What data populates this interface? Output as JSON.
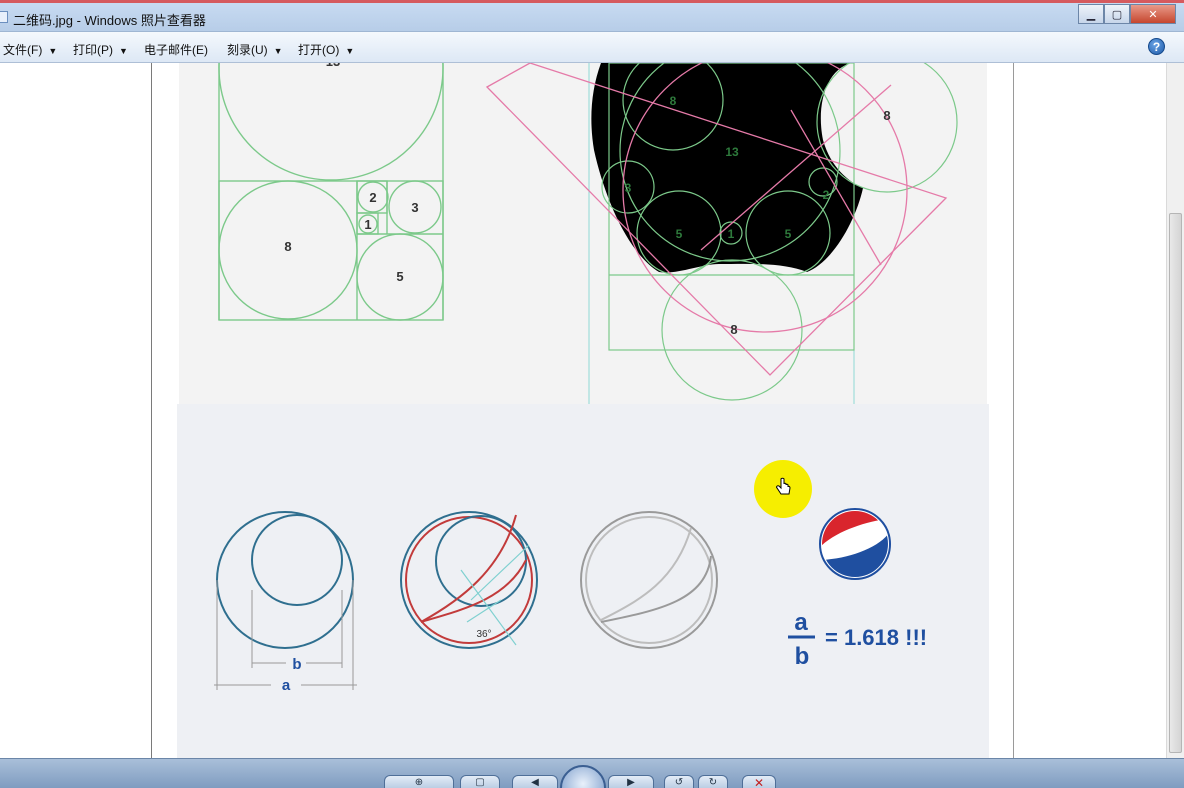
{
  "window": {
    "title": "二维码.jpg - Windows 照片查看器",
    "minimize_glyph": "▁",
    "maximize_glyph": "▢",
    "close_glyph": "✕"
  },
  "menu": {
    "items": [
      {
        "label": "文件(F)"
      },
      {
        "label": "打印(P)"
      },
      {
        "label": "电子邮件(E)"
      },
      {
        "label": "刻录(U)"
      },
      {
        "label": "打开(O)"
      }
    ],
    "caret": "▼",
    "help_glyph": "?"
  },
  "photo": {
    "fib_square_labels": {
      "top": "13",
      "c8": "8",
      "c2": "2",
      "c1": "1",
      "c3": "3",
      "c5": "5"
    },
    "apple_labels": {
      "a8": "8",
      "a13": "13",
      "a3": "3",
      "a5l": "5",
      "a1": "1",
      "a5r": "5",
      "a2": "2",
      "a8r": "8",
      "a8b": "8"
    },
    "pepsi": {
      "b_label": "b",
      "a_label": "a",
      "angle_label": "36°"
    },
    "formula": {
      "numerator": "a",
      "denominator": "b",
      "result": "= 1.618 !!!"
    }
  },
  "taskbar": {
    "buttons": [
      "⊕",
      "▢",
      "◀",
      "▶",
      "↺",
      "↻",
      "✕"
    ]
  },
  "colors": {
    "green": "#7cc98a",
    "pink": "#e57aa8",
    "teal": "#2f6f8f",
    "red": "#c23b3b",
    "pepsi_blue": "#1f4fa0",
    "pepsi_red": "#d9252d",
    "cursor_highlight": "#f6ee00"
  }
}
